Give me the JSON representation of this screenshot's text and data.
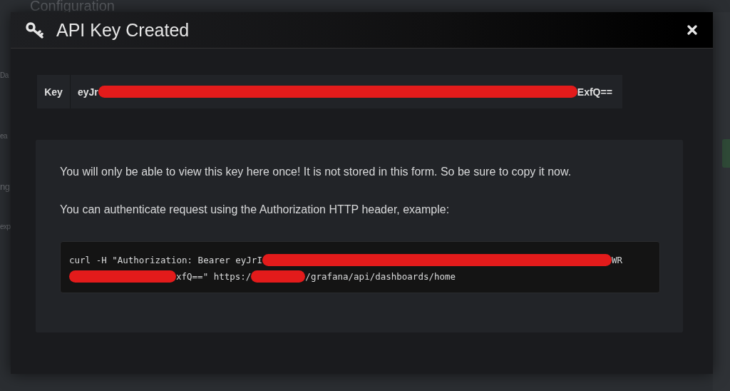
{
  "background_page": {
    "title": "Configuration",
    "sidebar_fragments": [
      "Da",
      "ea",
      "ng",
      "exp"
    ]
  },
  "modal": {
    "title": "API Key Created",
    "key": {
      "label": "Key",
      "value": [
        {
          "kind": "text",
          "text": "eyJr"
        },
        {
          "kind": "redaction"
        },
        {
          "kind": "text",
          "text": "ExfQ=="
        }
      ]
    },
    "info": {
      "paragraphs": [
        "You will only be able to view this key here once! It is not stored in this form. So be sure to copy it now.",
        "You can authenticate request using the Authorization HTTP header, example:"
      ],
      "code_lines": [
        [
          {
            "kind": "text",
            "text": "curl -H \"Authorization: Bearer eyJrI"
          },
          {
            "kind": "redaction"
          },
          {
            "kind": "text",
            "text": "WR"
          }
        ],
        [
          {
            "kind": "redaction"
          },
          {
            "kind": "text",
            "text": "xfQ==\" https:/"
          },
          {
            "kind": "redaction"
          },
          {
            "kind": "text",
            "text": "/grafana/api/dashboards/home"
          }
        ]
      ]
    }
  }
}
